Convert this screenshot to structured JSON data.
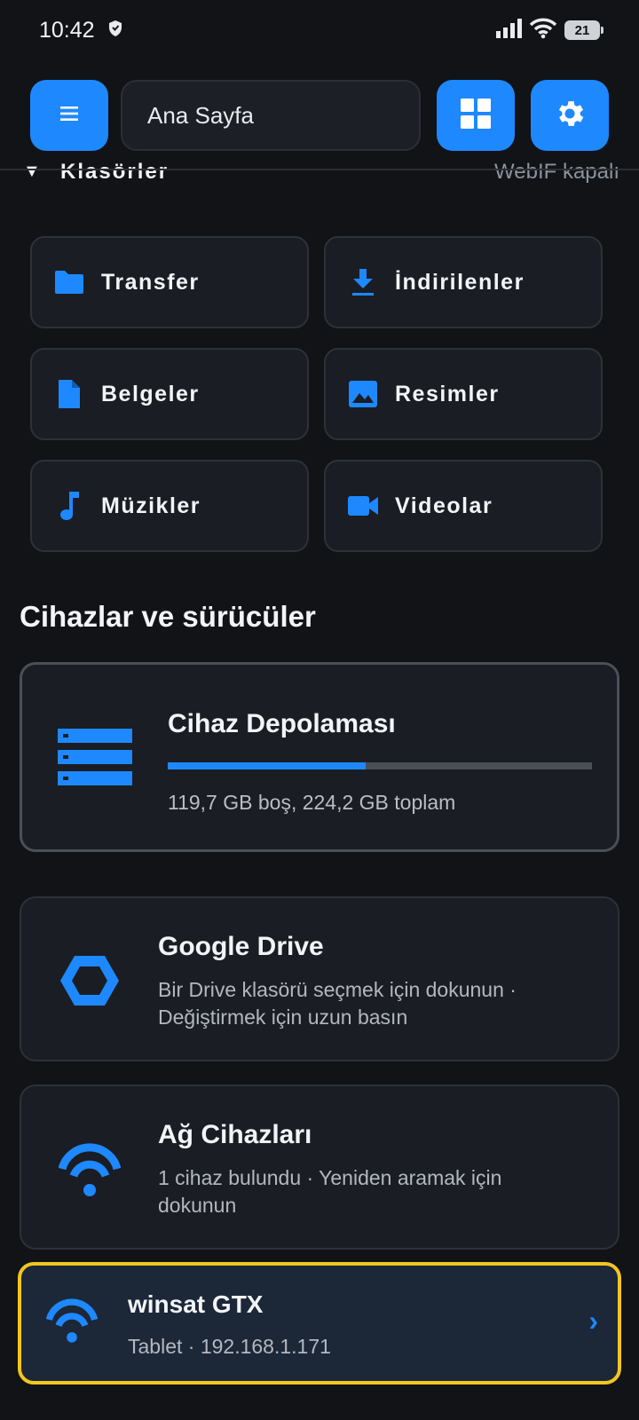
{
  "status_bar": {
    "time": "10:42",
    "battery": "21",
    "icons": [
      "shield-icon",
      "signal-icon",
      "wifi-icon",
      "battery-icon"
    ]
  },
  "toolbar": {
    "menu_icon": "hamburger-icon",
    "location": "Ana Sayfa",
    "grid_icon": "grid-icon",
    "settings_icon": "gear-icon",
    "accent": "#1e88ff"
  },
  "folders": {
    "title": "Klasörler",
    "webif_status": "WebIF kapalı",
    "items": [
      {
        "label": "Transfer",
        "icon": "folder-icon"
      },
      {
        "label": "İndirilenler",
        "icon": "download-icon"
      },
      {
        "label": "Belgeler",
        "icon": "document-icon"
      },
      {
        "label": "Resimler",
        "icon": "image-icon"
      },
      {
        "label": "Müzikler",
        "icon": "music-note-icon"
      },
      {
        "label": "Videolar",
        "icon": "video-camera-icon"
      }
    ]
  },
  "devices_section": {
    "title": "Cihazlar ve sürücüler",
    "storage": {
      "name": "Cihaz Depolaması",
      "used_fraction": 0.466,
      "detail": "119,7 GB boş, 224,2 GB toplam",
      "icon": "storage-icon"
    },
    "google_drive": {
      "name": "Google Drive",
      "detail": "Bir Drive klasörü seçmek için dokunun · Değiştirmek için uzun basın",
      "icon": "drive-hexagon-icon"
    },
    "network": {
      "name": "Ağ Cihazları",
      "detail": "1 cihaz bulundu · Yeniden aramak için dokunun",
      "icon": "network-wifi-icon"
    },
    "network_device": {
      "name": "winsat GTX",
      "detail": "Tablet · 192.168.1.171",
      "chevron": "›",
      "highlight": "#f2c61f"
    }
  }
}
